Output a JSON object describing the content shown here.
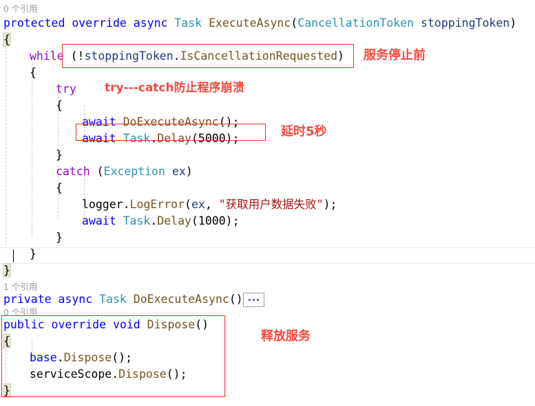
{
  "editor": {
    "language": "csharp",
    "theme": "visual-studio-light",
    "background": "#ffffff",
    "colors": {
      "keyword": "#0000FF",
      "control_keyword": "#8F08C4",
      "type": "#2B91AF",
      "method": "#74531F",
      "parameter": "#1F377F",
      "string": "#A31515",
      "plain_text": "#000000",
      "codelens": "#9A9A9A",
      "indent_guide": "#C8C8C8",
      "brace_match_bg": "#E3E7D2",
      "annotation_red": "#F4493D",
      "annotation_box_border": "#EE3124"
    },
    "codelens": {
      "executeasync": "0 个引用",
      "doexecuteasync": "1 个引用",
      "dispose": "0 个引用"
    },
    "collapsed_region_label": "...",
    "lines": [
      {
        "indent": 0,
        "tokens": [
          {
            "t": "protected",
            "c": "kw"
          },
          {
            "t": " ",
            "c": "plain"
          },
          {
            "t": "override",
            "c": "kw"
          },
          {
            "t": " ",
            "c": "plain"
          },
          {
            "t": "async",
            "c": "kw"
          },
          {
            "t": " ",
            "c": "plain"
          },
          {
            "t": "Task",
            "c": "type"
          },
          {
            "t": " ",
            "c": "plain"
          },
          {
            "t": "ExecuteAsync",
            "c": "meth"
          },
          {
            "t": "(",
            "c": "plain"
          },
          {
            "t": "CancellationToken",
            "c": "type"
          },
          {
            "t": " ",
            "c": "plain"
          },
          {
            "t": "stoppingToken",
            "c": "param"
          },
          {
            "t": ")",
            "c": "plain"
          }
        ]
      },
      {
        "indent": 0,
        "tokens": [
          {
            "t": "{",
            "c": "brace"
          }
        ]
      },
      {
        "indent": 1,
        "tokens": [
          {
            "t": "while",
            "c": "ctrl"
          },
          {
            "t": " ",
            "c": "plain"
          },
          {
            "t": "(!",
            "c": "plain"
          },
          {
            "t": "stoppingToken",
            "c": "param"
          },
          {
            "t": ".",
            "c": "plain"
          },
          {
            "t": "IsCancellationRequested",
            "c": "meth"
          },
          {
            "t": ")",
            "c": "plain"
          }
        ]
      },
      {
        "indent": 1,
        "tokens": [
          {
            "t": "{",
            "c": "brace"
          }
        ]
      },
      {
        "indent": 2,
        "tokens": [
          {
            "t": "try",
            "c": "ctrl"
          }
        ]
      },
      {
        "indent": 2,
        "tokens": [
          {
            "t": "{",
            "c": "brace"
          }
        ]
      },
      {
        "indent": 3,
        "tokens": [
          {
            "t": "await",
            "c": "kw"
          },
          {
            "t": " ",
            "c": "plain"
          },
          {
            "t": "DoExecuteAsync",
            "c": "meth"
          },
          {
            "t": "();",
            "c": "plain"
          }
        ]
      },
      {
        "indent": 3,
        "tokens": [
          {
            "t": "await",
            "c": "kw"
          },
          {
            "t": " ",
            "c": "plain"
          },
          {
            "t": "Task",
            "c": "type"
          },
          {
            "t": ".",
            "c": "plain"
          },
          {
            "t": "Delay",
            "c": "meth"
          },
          {
            "t": "(",
            "c": "plain"
          },
          {
            "t": "5000",
            "c": "num"
          },
          {
            "t": ");",
            "c": "plain"
          }
        ]
      },
      {
        "indent": 2,
        "tokens": [
          {
            "t": "}",
            "c": "brace"
          }
        ]
      },
      {
        "indent": 2,
        "tokens": [
          {
            "t": "catch",
            "c": "ctrl"
          },
          {
            "t": " (",
            "c": "plain"
          },
          {
            "t": "Exception",
            "c": "type"
          },
          {
            "t": " ",
            "c": "plain"
          },
          {
            "t": "ex",
            "c": "param"
          },
          {
            "t": ")",
            "c": "plain"
          }
        ]
      },
      {
        "indent": 2,
        "tokens": [
          {
            "t": "{",
            "c": "brace"
          }
        ]
      },
      {
        "indent": 3,
        "tokens": [
          {
            "t": "logger",
            "c": "plain"
          },
          {
            "t": ".",
            "c": "plain"
          },
          {
            "t": "LogError",
            "c": "meth"
          },
          {
            "t": "(",
            "c": "plain"
          },
          {
            "t": "ex",
            "c": "param"
          },
          {
            "t": ", ",
            "c": "plain"
          },
          {
            "t": "\"获取用户数据失败\"",
            "c": "str"
          },
          {
            "t": ");",
            "c": "plain"
          }
        ]
      },
      {
        "indent": 3,
        "tokens": [
          {
            "t": "await",
            "c": "kw"
          },
          {
            "t": " ",
            "c": "plain"
          },
          {
            "t": "Task",
            "c": "type"
          },
          {
            "t": ".",
            "c": "plain"
          },
          {
            "t": "Delay",
            "c": "meth"
          },
          {
            "t": "(",
            "c": "plain"
          },
          {
            "t": "1000",
            "c": "num"
          },
          {
            "t": ");",
            "c": "plain"
          }
        ]
      },
      {
        "indent": 2,
        "tokens": [
          {
            "t": "}",
            "c": "brace"
          }
        ]
      },
      {
        "indent": 1,
        "tokens": [
          {
            "t": "}",
            "c": "brace"
          }
        ]
      },
      {
        "indent": 0,
        "tokens": [
          {
            "t": "}",
            "c": "brace"
          }
        ]
      }
    ],
    "doexecuteasync_line": [
      {
        "t": "private",
        "c": "kw"
      },
      {
        "t": " ",
        "c": "plain"
      },
      {
        "t": "async",
        "c": "kw"
      },
      {
        "t": " ",
        "c": "plain"
      },
      {
        "t": "Task",
        "c": "type"
      },
      {
        "t": " ",
        "c": "plain"
      },
      {
        "t": "DoExecuteAsync",
        "c": "meth"
      },
      {
        "t": "()",
        "c": "plain"
      }
    ],
    "dispose_lines": [
      {
        "indent": 0,
        "tokens": [
          {
            "t": "public",
            "c": "kw"
          },
          {
            "t": " ",
            "c": "plain"
          },
          {
            "t": "override",
            "c": "kw"
          },
          {
            "t": " ",
            "c": "plain"
          },
          {
            "t": "void",
            "c": "kw"
          },
          {
            "t": " ",
            "c": "plain"
          },
          {
            "t": "Dispose",
            "c": "meth"
          },
          {
            "t": "()",
            "c": "plain"
          }
        ]
      },
      {
        "indent": 0,
        "tokens": [
          {
            "t": "{",
            "c": "brace"
          }
        ]
      },
      {
        "indent": 1,
        "tokens": [
          {
            "t": "base",
            "c": "kw"
          },
          {
            "t": ".",
            "c": "plain"
          },
          {
            "t": "Dispose",
            "c": "meth"
          },
          {
            "t": "();",
            "c": "plain"
          }
        ]
      },
      {
        "indent": 1,
        "tokens": [
          {
            "t": "serviceScope",
            "c": "plain"
          },
          {
            "t": ".",
            "c": "plain"
          },
          {
            "t": "Dispose",
            "c": "meth"
          },
          {
            "t": "();",
            "c": "plain"
          }
        ]
      },
      {
        "indent": 0,
        "tokens": [
          {
            "t": "}",
            "c": "brace"
          }
        ]
      }
    ]
  },
  "annotations": {
    "while_condition": "服务停止前",
    "try_catch": "try---catch防止程序崩溃",
    "delay": "延时5秒",
    "dispose": "释放服务"
  }
}
